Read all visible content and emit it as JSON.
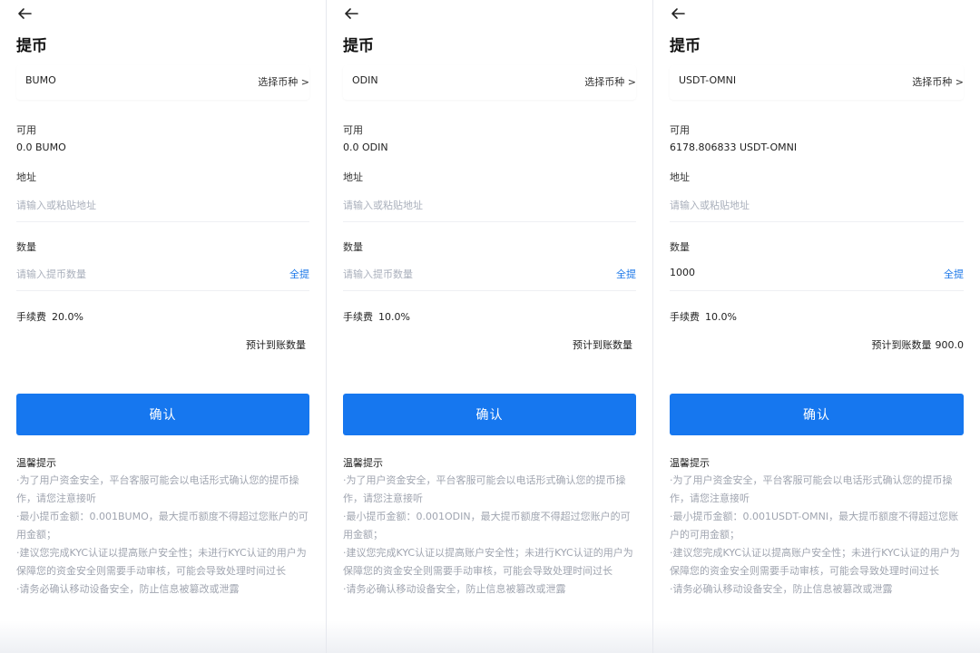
{
  "panels": [
    {
      "title": "提币",
      "coin": "BUMO",
      "select_label": "选择币种 >",
      "available_label": "可用",
      "available_value": "0.0 BUMO",
      "address_label": "地址",
      "address_placeholder": "请输入或粘贴地址",
      "amount_label": "数量",
      "amount_placeholder": "请输入提币数量",
      "amount_value": "",
      "all_label": "全提",
      "fee_label": "手续费",
      "fee_value": "20.0%",
      "expected_label": "预计到账数量",
      "expected_value": "",
      "confirm_label": "确认",
      "tips_title": "温馨提示",
      "tips": [
        "·为了用户资金安全，平台客服可能会以电话形式确认您的提币操作，请您注意接听",
        "·最小提币金额：0.001BUMO，最大提币额度不得超过您账户的可用金额；",
        "·建议您完成KYC认证以提高账户安全性；未进行KYC认证的用户为保障您的资金安全则需要手动审核，可能会导致处理时间过长",
        "·请务必确认移动设备安全，防止信息被篡改或泄露"
      ]
    },
    {
      "title": "提币",
      "coin": "ODIN",
      "select_label": "选择币种 >",
      "available_label": "可用",
      "available_value": "0.0 ODIN",
      "address_label": "地址",
      "address_placeholder": "请输入或粘贴地址",
      "amount_label": "数量",
      "amount_placeholder": "请输入提币数量",
      "amount_value": "",
      "all_label": "全提",
      "fee_label": "手续费",
      "fee_value": "10.0%",
      "expected_label": "预计到账数量",
      "expected_value": "",
      "confirm_label": "确认",
      "tips_title": "温馨提示",
      "tips": [
        "·为了用户资金安全，平台客服可能会以电话形式确认您的提币操作，请您注意接听",
        "·最小提币金额：0.001ODIN，最大提币额度不得超过您账户的可用金额；",
        "·建议您完成KYC认证以提高账户安全性；未进行KYC认证的用户为保障您的资金安全则需要手动审核，可能会导致处理时间过长",
        "·请务必确认移动设备安全，防止信息被篡改或泄露"
      ]
    },
    {
      "title": "提币",
      "coin": "USDT-OMNI",
      "select_label": "选择币种 >",
      "available_label": "可用",
      "available_value": "6178.806833 USDT-OMNI",
      "address_label": "地址",
      "address_placeholder": "请输入或粘贴地址",
      "amount_label": "数量",
      "amount_placeholder": "",
      "amount_value": "1000",
      "all_label": "全提",
      "fee_label": "手续费",
      "fee_value": "10.0%",
      "expected_label": "预计到账数量",
      "expected_value": "900.0",
      "confirm_label": "确认",
      "tips_title": "温馨提示",
      "tips": [
        "·为了用户资金安全，平台客服可能会以电话形式确认您的提币操作，请您注意接听",
        "·最小提币金额：0.001USDT-OMNI，最大提币额度不得超过您账户的可用金额；",
        "·建议您完成KYC认证以提高账户安全性；未进行KYC认证的用户为保障您的资金安全则需要手动审核，可能会导致处理时间过长",
        "·请务必确认移动设备安全，防止信息被篡改或泄露"
      ]
    }
  ],
  "colors": {
    "accent": "#1677ef",
    "link": "#1976e8",
    "placeholder": "#aab0bc",
    "tip_text": "#a0a5b0"
  },
  "icons": {
    "back": "arrow-left-icon"
  }
}
